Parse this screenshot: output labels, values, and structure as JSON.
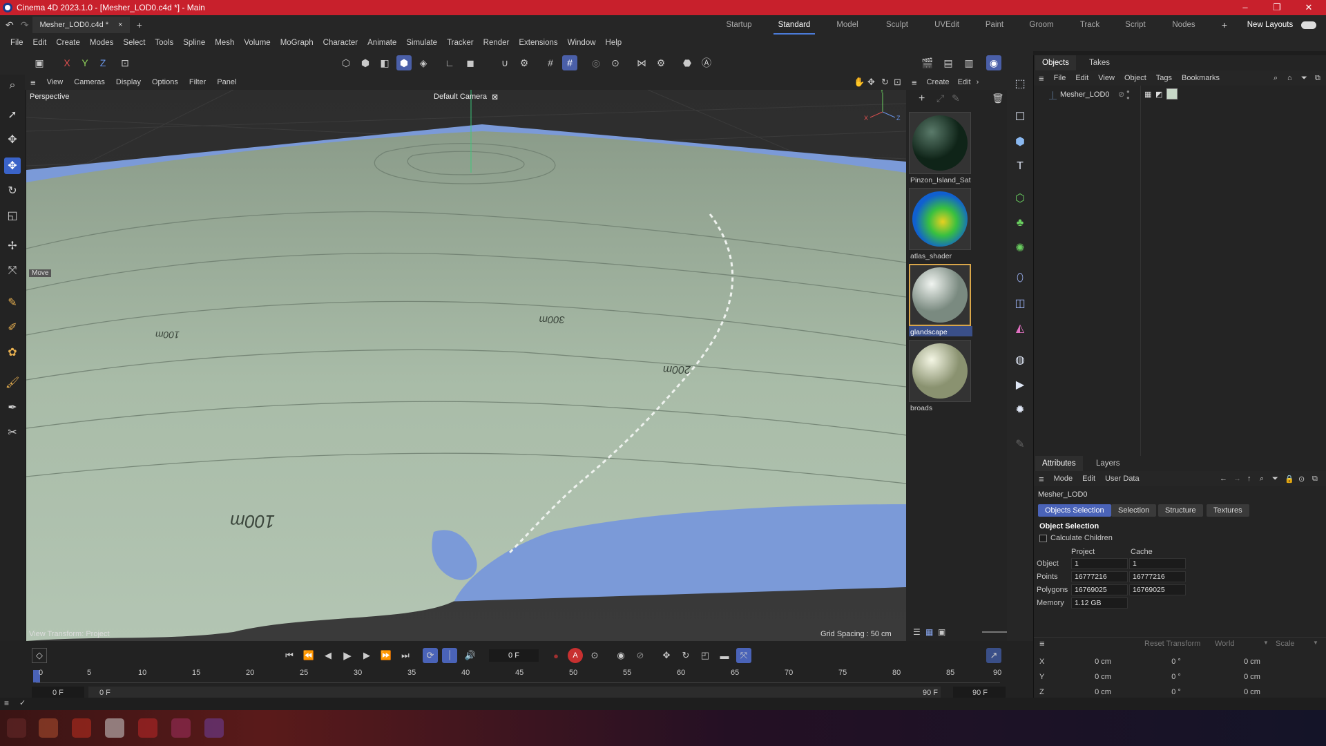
{
  "title_bar": {
    "title": "Cinema 4D 2023.1.0 - [Mesher_LOD0.c4d *] - Main",
    "minimize": "–",
    "maximize": "❐",
    "close": "✕"
  },
  "doc_tab": {
    "name": "Mesher_LOD0.c4d *",
    "close": "×",
    "add": "+"
  },
  "layouts": [
    "Startup",
    "Standard",
    "Model",
    "Sculpt",
    "UVEdit",
    "Paint",
    "Groom",
    "Track",
    "Script",
    "Nodes"
  ],
  "layouts_add": "+",
  "new_layouts": "New Layouts",
  "menu": [
    "File",
    "Edit",
    "Create",
    "Modes",
    "Select",
    "Tools",
    "Spline",
    "Mesh",
    "Volume",
    "MoGraph",
    "Character",
    "Animate",
    "Simulate",
    "Tracker",
    "Render",
    "Extensions",
    "Window",
    "Help"
  ],
  "toolbar_axes": [
    "X",
    "Y",
    "Z"
  ],
  "viewport": {
    "menu": [
      "View",
      "Cameras",
      "Display",
      "Options",
      "Filter",
      "Panel"
    ],
    "projection": "Perspective",
    "camera": "Default Camera",
    "view_transform": "View Transform: Project",
    "grid_spacing": "Grid Spacing : 50 cm",
    "move_label": "Move",
    "contour_labels": [
      "100m",
      "200m",
      "300m",
      "100m"
    ],
    "axis_labels": [
      "Y",
      "X",
      "Z"
    ]
  },
  "material_panel": {
    "menu": [
      "Create",
      "Edit"
    ],
    "materials": [
      {
        "name": "Pinzon_Island_Sat",
        "selected": false
      },
      {
        "name": "atlas_shader",
        "selected": false
      },
      {
        "name": "glandscape",
        "selected": true
      },
      {
        "name": "broads",
        "selected": false
      }
    ]
  },
  "objects_panel": {
    "tabs": [
      "Objects",
      "Takes"
    ],
    "menu": [
      "File",
      "Edit",
      "View",
      "Object",
      "Tags",
      "Bookmarks"
    ],
    "items": [
      {
        "name": "Mesher_LOD0"
      }
    ]
  },
  "attributes_panel": {
    "tabs": [
      "Attributes",
      "Layers"
    ],
    "menu": [
      "Mode",
      "Edit",
      "User Data"
    ],
    "object_name": "Mesher_LOD0",
    "sub_tabs": [
      "Objects Selection",
      "Selection",
      "Structure",
      "Textures"
    ],
    "section_title": "Object Selection",
    "calculate_children": "Calculate Children",
    "columns": [
      "Project",
      "Cache"
    ],
    "rows": [
      {
        "label": "Object",
        "project": "1",
        "cache": "1"
      },
      {
        "label": "Points",
        "project": "16777216",
        "cache": "16777216"
      },
      {
        "label": "Polygons",
        "project": "16769025",
        "cache": "16769025"
      },
      {
        "label": "Memory",
        "project": "1.12 GB",
        "cache": ""
      }
    ],
    "coord_buttons": [
      "Reset Transform",
      "World",
      "Scale"
    ],
    "coords": [
      {
        "axis": "X",
        "p": "0 cm",
        "r": "0 °",
        "s": "0 cm"
      },
      {
        "axis": "Y",
        "p": "0 cm",
        "r": "0 °",
        "s": "0 cm"
      },
      {
        "axis": "Z",
        "p": "0 cm",
        "r": "0 °",
        "s": "0 cm"
      }
    ]
  },
  "timeline": {
    "current_frame": "0 F",
    "ticks": [
      "0",
      "5",
      "10",
      "15",
      "20",
      "25",
      "30",
      "35",
      "40",
      "45",
      "50",
      "55",
      "60",
      "65",
      "70",
      "75",
      "80",
      "85",
      "90"
    ],
    "start": "0 F",
    "range_start": "0 F",
    "range_end": "90 F",
    "end": "90 F",
    "key_auto": "A"
  },
  "colors": {
    "title_bar": "#c8202c",
    "accent": "#4a63b8",
    "terrain": "#a9bca8",
    "water": "#7b9ad8"
  }
}
